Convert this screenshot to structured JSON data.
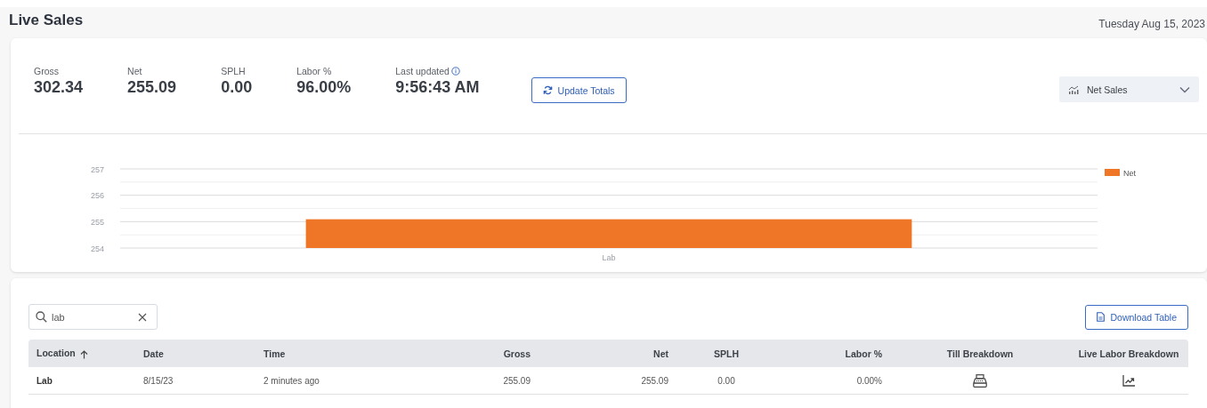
{
  "page": {
    "title": "Live Sales",
    "date": "Tuesday Aug 15, 2023"
  },
  "stats": [
    {
      "label": "Gross",
      "value": "302.34",
      "kind": "plain"
    },
    {
      "label": "Net",
      "value": "255.09",
      "kind": "plain"
    },
    {
      "label": "SPLH",
      "value": "0.00",
      "kind": "plain"
    },
    {
      "label": "Labor %",
      "value": "96.00%",
      "kind": "plain"
    },
    {
      "label": "Last updated",
      "value": "9:56:43 AM",
      "kind": "info"
    }
  ],
  "update_button": "Update Totals",
  "chart_select": {
    "value": "Net Sales"
  },
  "chart_data": {
    "type": "bar",
    "categories": [
      "Lab"
    ],
    "series": [
      {
        "name": "Net",
        "color": "#f07627",
        "values": [
          255.09
        ]
      }
    ],
    "ylim": [
      254,
      257
    ],
    "yticks": [
      254,
      255,
      256,
      257
    ]
  },
  "search": {
    "value": "lab"
  },
  "download_button": "Download Table",
  "table": {
    "columns": [
      {
        "label": "Location",
        "sorted": true
      },
      {
        "label": "Date",
        "sorted": false
      },
      {
        "label": "Time",
        "sorted": false
      },
      {
        "label": "Gross",
        "sorted": false
      },
      {
        "label": "Net",
        "sorted": false
      },
      {
        "label": "SPLH",
        "sorted": false
      },
      {
        "label": "Labor %",
        "sorted": false
      },
      {
        "label": "Till Breakdown",
        "sorted": false
      },
      {
        "label": "Live Labor Breakdown",
        "sorted": false
      }
    ],
    "rows": [
      {
        "cells": [
          {
            "kind": "text",
            "text": "Lab"
          },
          {
            "kind": "text",
            "text": "8/15/23"
          },
          {
            "kind": "text",
            "text": "2 minutes ago"
          },
          {
            "kind": "text",
            "text": "255.09"
          },
          {
            "kind": "text",
            "text": "255.09"
          },
          {
            "kind": "text",
            "text": "0.00"
          },
          {
            "kind": "text",
            "text": "0.00%"
          },
          {
            "kind": "register"
          },
          {
            "kind": "trend"
          }
        ]
      }
    ]
  }
}
